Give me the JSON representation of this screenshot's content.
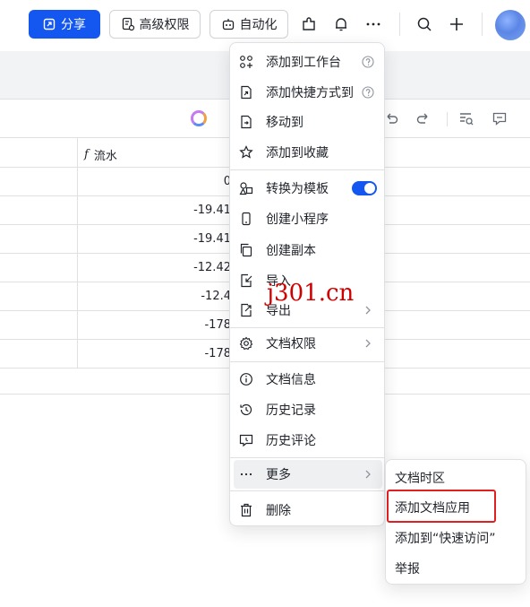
{
  "topbar": {
    "share_label": "分享",
    "permission_label": "高级权限",
    "automation_label": "自动化"
  },
  "sheet": {
    "column_header": "流水",
    "values": [
      "0",
      "-19.41",
      "-19.41",
      "-12.42",
      "-12.4",
      "-178",
      "-178"
    ]
  },
  "menu": {
    "items": [
      {
        "label": "添加到工作台",
        "icon": "add-to-workspace-icon"
      },
      {
        "label": "添加快捷方式到",
        "icon": "shortcut-icon"
      },
      {
        "label": "移动到",
        "icon": "move-icon"
      },
      {
        "label": "添加到收藏",
        "icon": "star-icon"
      },
      {
        "label": "转换为模板",
        "icon": "template-icon"
      },
      {
        "label": "创建小程序",
        "icon": "mini-program-icon"
      },
      {
        "label": "创建副本",
        "icon": "copy-icon"
      },
      {
        "label": "导入",
        "icon": "import-icon"
      },
      {
        "label": "导出",
        "icon": "export-icon"
      },
      {
        "label": "文档权限",
        "icon": "gear-icon"
      },
      {
        "label": "文档信息",
        "icon": "info-icon"
      },
      {
        "label": "历史记录",
        "icon": "history-icon"
      },
      {
        "label": "历史评论",
        "icon": "comment-history-icon"
      },
      {
        "label": "更多",
        "icon": "more-icon"
      },
      {
        "label": "删除",
        "icon": "trash-icon"
      }
    ]
  },
  "submenu": {
    "items": [
      "文档时区",
      "添加文档应用",
      "添加到“快速访问”",
      "举报"
    ]
  },
  "watermark": "j301.cn",
  "colors": {
    "primary": "#1456f0",
    "highlight_border": "#e02020",
    "watermark": "#d00000"
  }
}
